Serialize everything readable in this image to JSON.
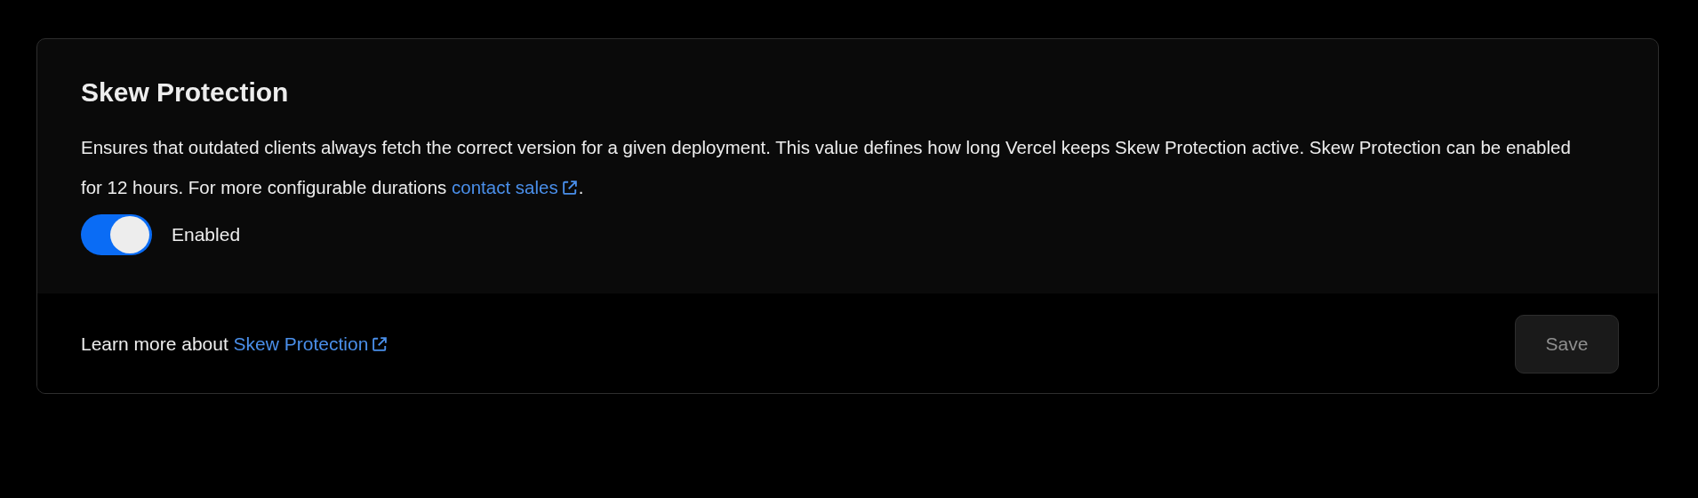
{
  "card": {
    "title": "Skew Protection",
    "description": {
      "text": "Ensures that outdated clients always fetch the correct version for a given deployment. This value defines how long Vercel keeps Skew Protection active. Skew Protection can be enabled for 12 hours. For more configurable durations",
      "link": "contact sales",
      "after": "."
    },
    "toggle": {
      "label": "Enabled",
      "on": true
    },
    "footer": {
      "text": "Learn more about",
      "link": "Skew Protection"
    },
    "save_button": {
      "label": "Save",
      "disabled": true
    }
  }
}
